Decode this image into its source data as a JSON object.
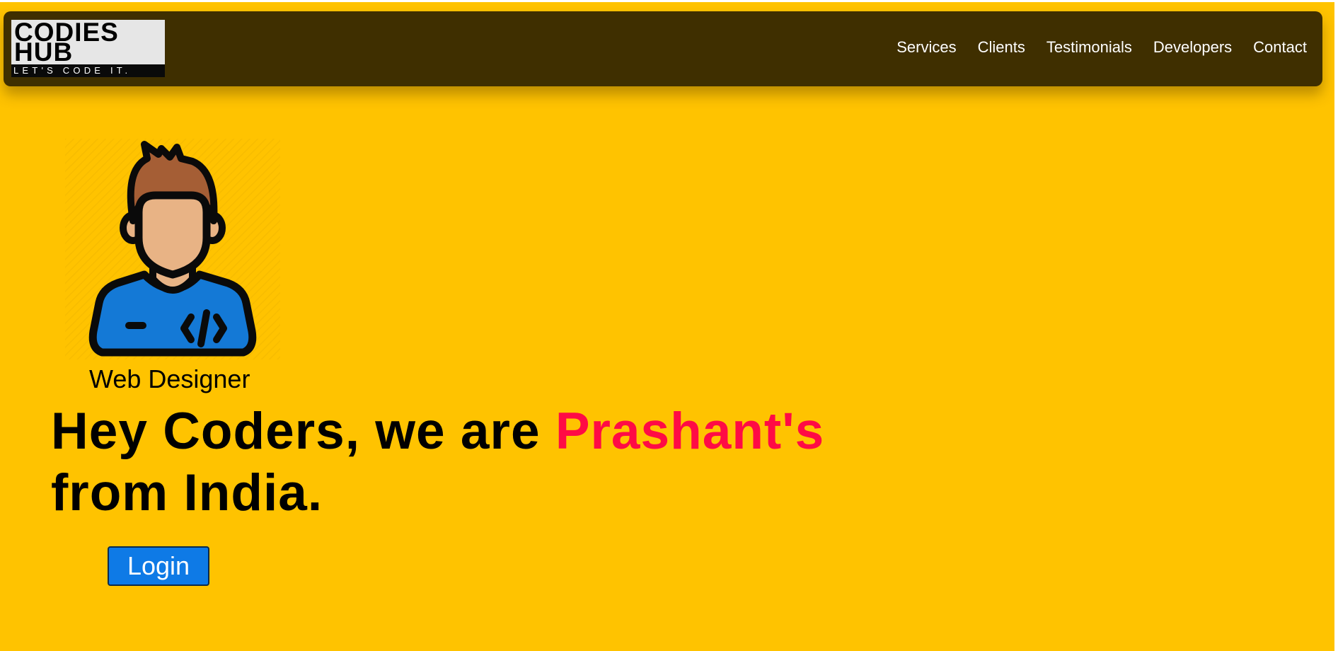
{
  "colors": {
    "page_background": "#FFC300",
    "navbar_background": "#3F2F00",
    "accent": "#FF0B45",
    "button": "#0E7AE6"
  },
  "logo": {
    "line1": "CODIES",
    "line2": "HUB",
    "tagline": "LET'S CODE IT."
  },
  "nav": {
    "items": [
      {
        "label": "Services"
      },
      {
        "label": "Clients"
      },
      {
        "label": "Testimonials"
      },
      {
        "label": "Developers"
      },
      {
        "label": "Contact"
      }
    ]
  },
  "hero": {
    "avatar_icon": "developer-avatar-icon",
    "role": "Web Designer",
    "headline_prefix": "Hey Coders, we are ",
    "headline_highlight": "Prashant's",
    "headline_suffix": " from India.",
    "login_label": "Login"
  }
}
